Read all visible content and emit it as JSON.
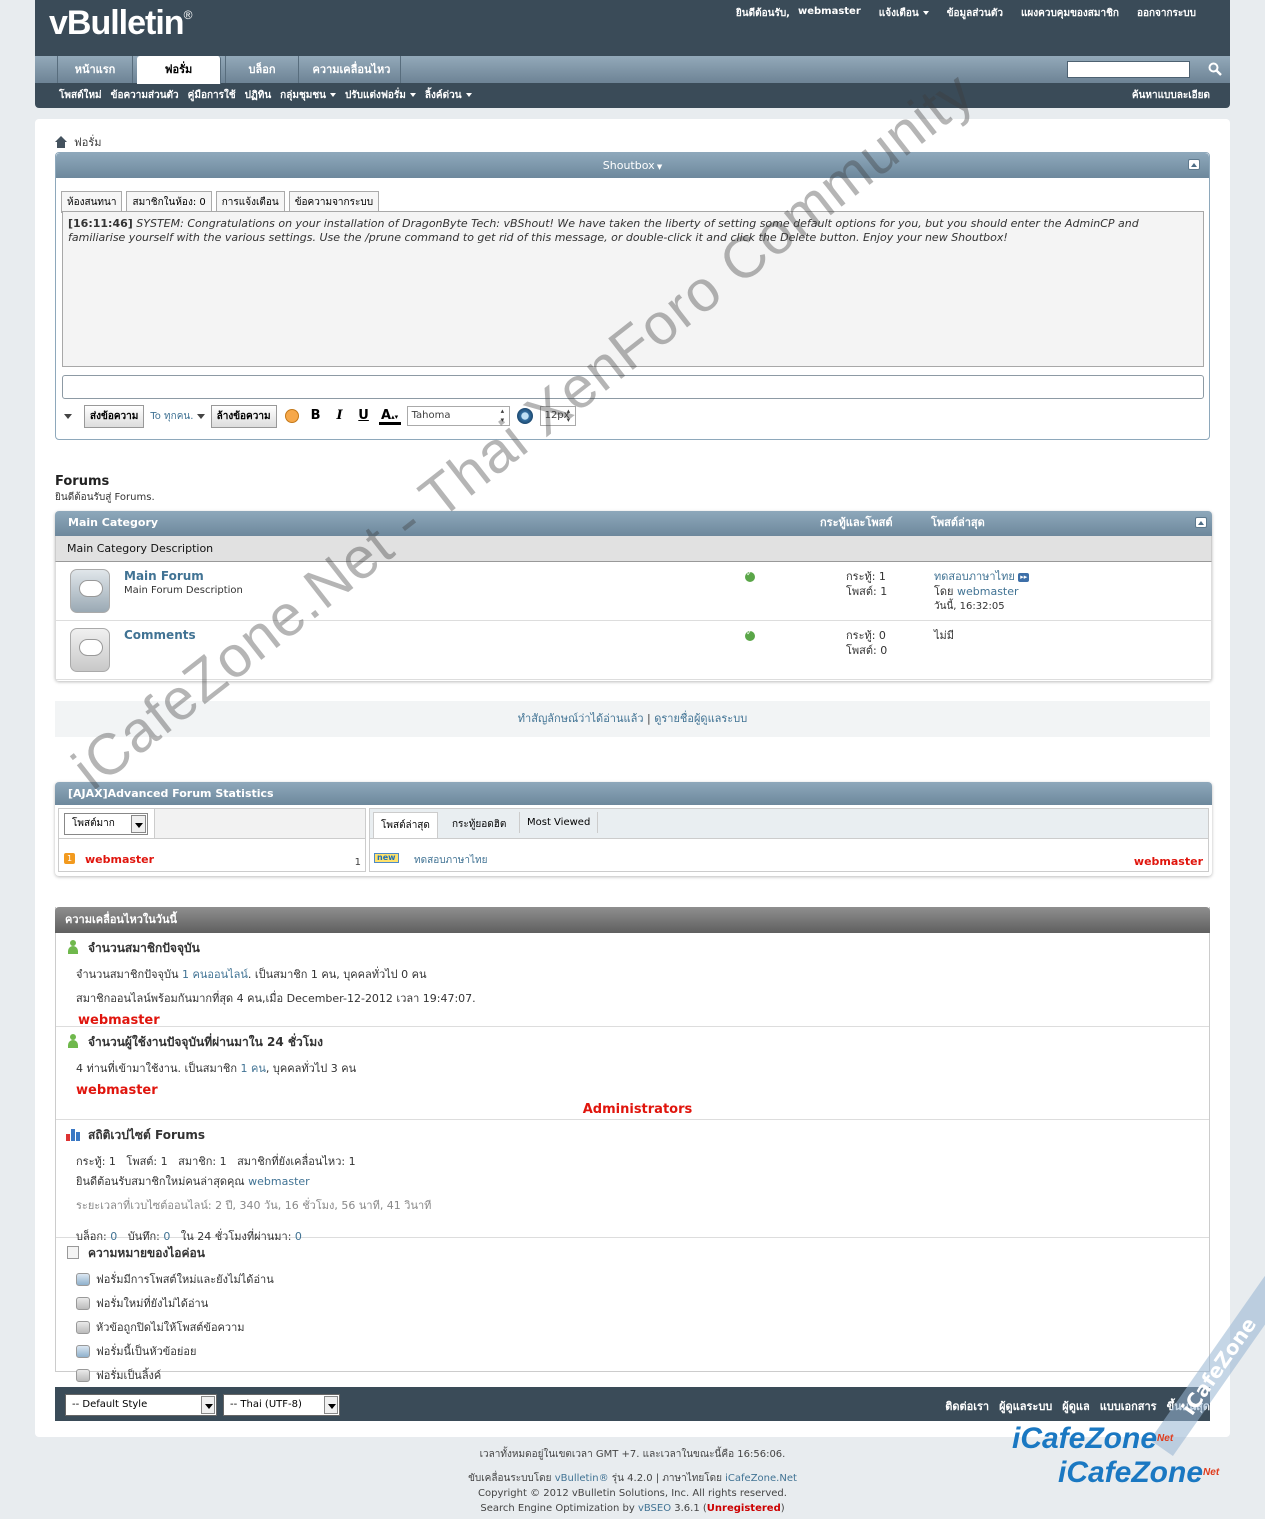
{
  "header": {
    "logo": "vBulletin",
    "logo_mark": "®",
    "toplinks": [
      "ยินดีต้อนรับ,",
      "webmaster",
      "แจ้งเตือน",
      "ข้อมูลส่วนตัว",
      "แผงควบคุมของสมาชิก",
      "ออกจากระบบ"
    ],
    "tabs": [
      "หน้าแรก",
      "ฟอรั่ม",
      "บล็อก",
      "ความเคลื่อนไหว"
    ],
    "active_tab": "ฟอรั่ม",
    "search_placeholder": "",
    "subnav": [
      "โพสต์ใหม่",
      "ข้อความส่วนตัว",
      "คู่มือการใช้",
      "ปฏิทิน",
      "กลุ่มชุมชน",
      "ปรับแต่งฟอรั่ม",
      "ลิ้งค์ด่วน"
    ],
    "advanced_search": "ค้นหาแบบละเอียด"
  },
  "breadcrumb": {
    "label": "ฟอรั่ม"
  },
  "shoutbox": {
    "title": "Shoutbox",
    "tabs": [
      "ห้องสนทนา",
      "สมาชิกในห้อง: 0",
      "การแจ้งเตือน",
      "ข้อความจากระบบ"
    ],
    "message_time": "[16:11:46]",
    "message_text": "SYSTEM: Congratulations on your installation of DragonByte Tech: vBShout! We have taken the liberty of setting some default options for you, but you should enter the AdminCP and familiarise yourself with the various settings. Use the /prune command to get rid of this message, or double-click it and click the Delete button. Enjoy your new Shoutbox!",
    "send_button": "ส่งข้อความ",
    "to_label": "To ทุกคน.",
    "clear_button": "ล้างข้อความ",
    "font": "Tahoma",
    "size": "12px"
  },
  "forums": {
    "title": "Forums",
    "welcome": "ยินดีต้อนรับสู่ Forums.",
    "category": "Main Category",
    "col_threads": "กระทู้และโพสต์",
    "col_last": "โพสต์ล่าสุด",
    "category_desc": "Main Category Description",
    "rows": [
      {
        "name": "Main Forum",
        "desc": "Main Forum Description",
        "threads": "กระทู้: 1",
        "posts": "โพสต์: 1",
        "last_title": "ทดสอบภาษาไทย",
        "last_by_label": "โดย",
        "last_by": "webmaster",
        "last_time": "วันนี้, 16:32:05"
      },
      {
        "name": "Comments",
        "desc": "",
        "threads": "กระทู้: 0",
        "posts": "โพสต์: 0",
        "last_title": "ไม่มี",
        "last_by_label": "",
        "last_by": "",
        "last_time": ""
      }
    ],
    "mark_read": "ทำสัญลักษณ์ว่าได้อ่านแล้ว",
    "separator": "|",
    "view_staff": "ดูรายชื่อผู้ดูแลระบบ"
  },
  "afs": {
    "title": "[AJAX]Advanced Forum Statistics",
    "select": "โพสต์มาก",
    "top_user": "webmaster",
    "top_count": "1",
    "tabs": [
      "โพสต์ล่าสุด",
      "กระทู้ยอดฮิต",
      "Most Viewed"
    ],
    "new_badge": "new",
    "latest_thread": "ทดสอบภาษาไทย",
    "latest_user": "webmaster"
  },
  "wol": {
    "title": "ความเคลื่อนไหวในวันนี้",
    "online_title": "จำนวนสมาชิกปัจจุบัน",
    "online_line1_a": "จำนวนสมาชิกปัจจุบัน",
    "online_line1_link": "1 คนออนไลน์",
    "online_line1_b": ". เป็นสมาชิก 1 คน, บุคคลทั่วไป 0 คน",
    "online_line2": "สมาชิกออนไลน์พร้อมกันมากที่สุด 4 คน,เมื่อ December-12-2012 เวลา 19:47:07.",
    "online_user": "webmaster",
    "day_title": "จำนวนผู้ใช้งานปัจจุบันที่ผ่านมาใน 24 ชั่วโมง",
    "day_line_a": "4 ท่านที่เข้ามาใช้งาน. เป็นสมาชิก",
    "day_line_link": "1 คน",
    "day_line_b": ", บุคคลทั่วไป 3 คน",
    "day_user": "webmaster",
    "admins": "Administrators",
    "stats_title": "สถิติเวปไซต์ Forums",
    "stats_line1": "กระทู้: 1   โพสต์: 1   สมาชิก: 1   สมาชิกที่ยังเคลื่อนไหว: 1",
    "stats_line2_a": "ยินดีต้อนรับสมาชิกใหม่คนล่าสุดคุณ",
    "stats_line2_link": "webmaster",
    "stats_line3": "ระยะเวลาที่เวบไซต์ออนไลน์: 2 ปี, 340 วัน, 16 ชั่วโมง, 56 นาที, 41 วินาที",
    "blog_label": "บล็อก:",
    "blog_val": "0",
    "entries_label": "บันทึก:",
    "entries_val": "0",
    "last24_label": "ใน 24 ชั่วโมงที่ผ่านมา:",
    "last24_val": "0",
    "legend_title": "ความหมายของไอค่อน",
    "legend": [
      "ฟอรั่มมีการโพสต์ใหม่และยังไม่ได้อ่าน",
      "ฟอรั่มใหม่ที่ยังไม่ได้อ่าน",
      "หัวข้อถูกปิดไม่ให้โพสต์ข้อความ",
      "ฟอรั่มนี้เป็นหัวข้อย่อย",
      "ฟอรั่มเป็นลิ้งค์"
    ]
  },
  "footer": {
    "style_select": "-- Default Style",
    "lang_select": "-- Thai (UTF-8)",
    "links": [
      "ติดต่อเรา",
      "ผู้ดูแลระบบ",
      "ผู้ดูแล",
      "แบบเอกสาร",
      "ขึ้นบนสุด"
    ],
    "time_line": "เวลาทั้งหมดอยู่ในเขตเวลา GMT +7. และเวลาในขณะนี้คือ 16:56:06.",
    "powered_a": "ขับเคลื่อนระบบโดย",
    "powered_link": "vBulletin®",
    "powered_b": "รุ่น 4.2.0 | ภาษาไทยโดย",
    "powered_link2": "iCafeZone.Net",
    "copyright": "Copyright © 2012 vBulletin Solutions, Inc. All rights reserved.",
    "seo_a": "Search Engine Optimization by",
    "seo_link": "vBSEO",
    "seo_b": "3.6.1 (",
    "seo_unreg": "Unregistered",
    "seo_c": ")"
  },
  "watermark": {
    "diagonal": "iCafeZone.Net - Thai XenForo Community",
    "logo1": "iCafeZone",
    "logo2": "iCafeZone",
    "logo_sup": "Net",
    "band": "iCafeZone"
  },
  "colors": {
    "header_bg": "#3a4b58",
    "accent": "#417394",
    "red": "#e0150d"
  }
}
